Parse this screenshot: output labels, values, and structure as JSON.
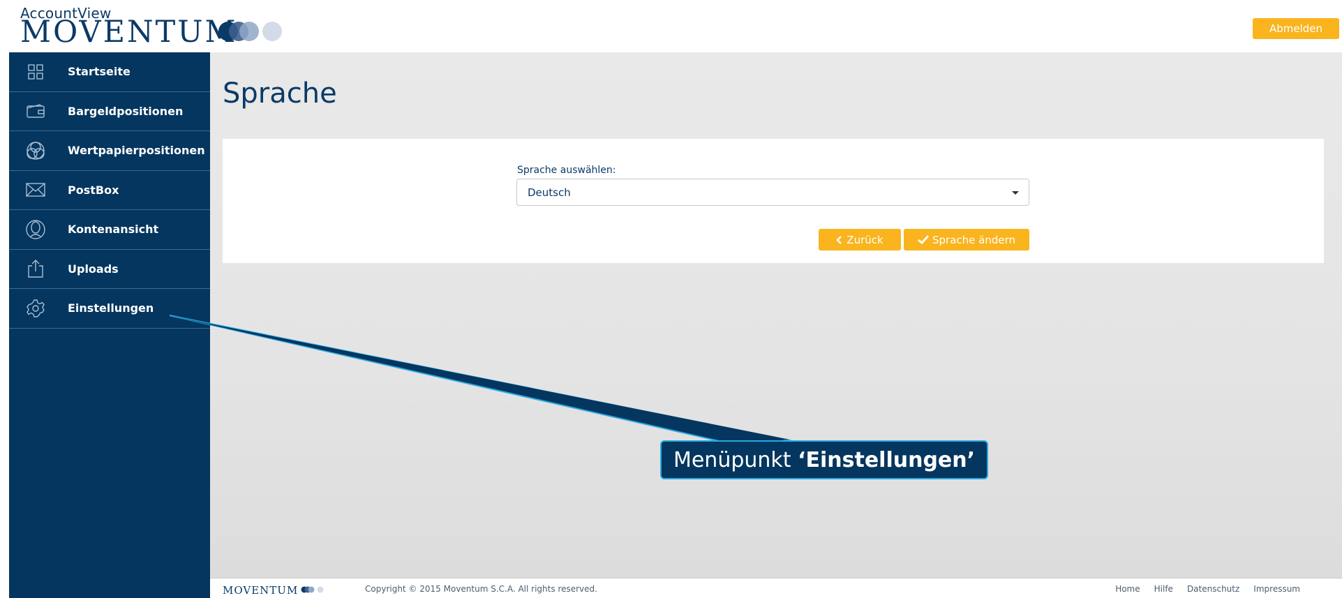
{
  "header": {
    "app_name": "AccountView",
    "brand": "MOVENTUM",
    "logout_label": "Abmelden"
  },
  "sidebar": {
    "items": [
      {
        "label": "Startseite",
        "icon": "grid-icon"
      },
      {
        "label": "Bargeldpositionen",
        "icon": "wallet-icon"
      },
      {
        "label": "Wertpapierpositionen",
        "icon": "overlapping-circles-icon"
      },
      {
        "label": "PostBox",
        "icon": "envelope-icon"
      },
      {
        "label": "Kontenansicht",
        "icon": "person-circle-icon"
      },
      {
        "label": "Uploads",
        "icon": "upload-icon"
      },
      {
        "label": "Einstellungen",
        "icon": "gear-icon"
      }
    ]
  },
  "main": {
    "title": "Sprache",
    "select_label": "Sprache auswählen:",
    "select_value": "Deutsch",
    "back_label": "Zurück",
    "change_label": "Sprache ändern"
  },
  "callout": {
    "prefix": "Menüpunkt ",
    "highlight": "‘Einstellungen’"
  },
  "footer": {
    "brand": "MOVENTUM",
    "copyright": "Copyright © 2015 Moventum S.C.A. All rights reserved.",
    "links": [
      "Home",
      "Hilfe",
      "Datenschutz",
      "Impressum"
    ]
  },
  "colors": {
    "navy": "#04365f",
    "accent": "#f9b41e",
    "callout_border": "#29a8e0"
  }
}
